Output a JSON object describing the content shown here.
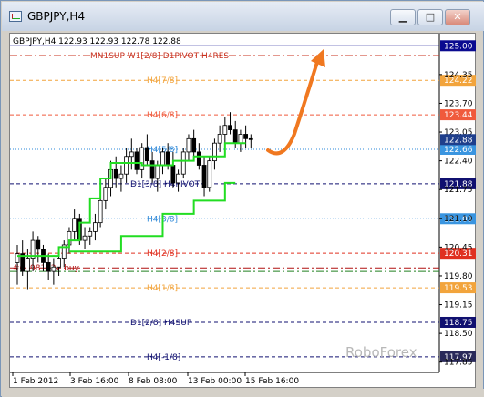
{
  "window": {
    "title": "GBPJPY,H4",
    "buttons": {
      "minimize": "▁",
      "maximize": "□",
      "close": "✕"
    }
  },
  "header": {
    "symbol_line": "GBPJPY,H4  122.93 122.93 122.78 122.88"
  },
  "watermark": "RoboForex",
  "price_scale": {
    "ticks": [
      "124.35",
      "123.70",
      "123.05",
      "122.40",
      "121.75",
      "121.10",
      "120.45",
      "119.80",
      "119.15",
      "118.50",
      "117.85"
    ],
    "current_price": "122.88",
    "current_color": "#1f3f8c"
  },
  "levels": [
    {
      "name": "top-line",
      "price": 125.0,
      "label": "",
      "tag": "125.00",
      "color": "#0a0a90",
      "style": "solid",
      "tag_bg": "#0a0a90"
    },
    {
      "name": "mn1sup",
      "price": 124.78,
      "label": "MN1SUP  W1[2/8]  D1PIVOT  H4RES",
      "tag": "",
      "color": "#c8301e",
      "style": "dashdot",
      "tag_bg": ""
    },
    {
      "name": "h4-7-8",
      "price": 124.22,
      "label": "H4[7/8]",
      "tag": "124.22",
      "color": "#f2a43c",
      "style": "dash",
      "tag_bg": "#f2a43c"
    },
    {
      "name": "h4-6-8",
      "price": 123.44,
      "label": "H4[6/8]",
      "tag": "123.44",
      "color": "#f05a3c",
      "style": "dash",
      "tag_bg": "#f05a3c"
    },
    {
      "name": "h4-5-8",
      "price": 122.66,
      "label": "H4[5/8]",
      "tag": "122.66",
      "color": "#2e88d8",
      "style": "dot",
      "tag_bg": "#3a95e0"
    },
    {
      "name": "d1-pivot",
      "price": 121.88,
      "label": "D1[3/8]  H4PIVOT",
      "tag": "121.88",
      "color": "#101070",
      "style": "dash",
      "tag_bg": "#101070"
    },
    {
      "name": "h4-3-8",
      "price": 121.09,
      "label": "H4[3/8]",
      "tag": "121.09",
      "color": "#2e88d8",
      "style": "dot",
      "tag_bg": "#3a95e0"
    },
    {
      "name": "h4-2-8",
      "price": 120.31,
      "label": "H4[2/8]",
      "tag": "120.31",
      "color": "#e03020",
      "style": "dash",
      "tag_bg": "#e03020"
    },
    {
      "name": "buy-line",
      "price": 119.98,
      "label": "#63981522 buy",
      "tag": "",
      "color": "#b01010",
      "style": "dashdot",
      "tag_bg": ""
    },
    {
      "name": "green-line",
      "price": 119.9,
      "label": "",
      "tag": "",
      "color": "#208020",
      "style": "dashdot",
      "tag_bg": ""
    },
    {
      "name": "h4-1-8",
      "price": 119.53,
      "label": "H4[1/8]",
      "tag": "119.53",
      "color": "#f2a43c",
      "style": "dash",
      "tag_bg": "#f2a43c"
    },
    {
      "name": "d1-h4sup",
      "price": 118.75,
      "label": "D1[2/8]  H4SUP",
      "tag": "118.75",
      "color": "#101070",
      "style": "dash",
      "tag_bg": "#101070"
    },
    {
      "name": "h4-0-8",
      "price": 117.97,
      "label": "H4[-1/8]",
      "tag": "117.97",
      "color": "#101070",
      "style": "dash",
      "tag_bg": "#2a2a5a"
    }
  ],
  "time_axis": [
    "1 Feb 2012",
    "3 Feb 16:00",
    "8 Feb 08:00",
    "13 Feb 00:00",
    "15 Feb 16:00"
  ],
  "candles": [
    [
      120.1,
      120.5,
      119.6,
      120.3
    ],
    [
      120.3,
      120.6,
      119.8,
      119.9
    ],
    [
      119.9,
      120.4,
      119.5,
      120.2
    ],
    [
      120.2,
      120.8,
      119.9,
      120.6
    ],
    [
      120.6,
      120.7,
      120.1,
      120.4
    ],
    [
      120.4,
      120.5,
      119.9,
      120.1
    ],
    [
      120.1,
      120.3,
      119.7,
      119.9
    ],
    [
      119.9,
      120.2,
      119.6,
      120.0
    ],
    [
      120.0,
      120.3,
      119.8,
      120.2
    ],
    [
      120.2,
      120.6,
      120.0,
      120.5
    ],
    [
      120.5,
      120.9,
      120.3,
      120.8
    ],
    [
      120.8,
      121.3,
      120.6,
      121.1
    ],
    [
      121.1,
      121.2,
      120.5,
      120.6
    ],
    [
      120.6,
      120.9,
      120.4,
      120.7
    ],
    [
      120.7,
      120.9,
      120.5,
      120.8
    ],
    [
      120.8,
      121.2,
      120.6,
      121.0
    ],
    [
      121.0,
      121.6,
      120.9,
      121.5
    ],
    [
      121.5,
      122.0,
      121.3,
      121.8
    ],
    [
      121.8,
      122.4,
      121.6,
      122.2
    ],
    [
      122.2,
      122.5,
      121.8,
      122.0
    ],
    [
      122.0,
      122.3,
      121.7,
      122.1
    ],
    [
      122.1,
      122.7,
      121.9,
      122.5
    ],
    [
      122.5,
      122.9,
      122.2,
      122.6
    ],
    [
      122.6,
      122.7,
      122.1,
      122.2
    ],
    [
      122.2,
      122.8,
      122.0,
      122.7
    ],
    [
      122.7,
      123.0,
      122.3,
      122.4
    ],
    [
      122.4,
      122.6,
      121.9,
      122.0
    ],
    [
      122.0,
      122.4,
      121.7,
      122.3
    ],
    [
      122.3,
      122.7,
      122.1,
      122.6
    ],
    [
      122.6,
      122.8,
      122.2,
      122.3
    ],
    [
      122.3,
      122.6,
      121.8,
      121.9
    ],
    [
      121.9,
      122.2,
      121.7,
      122.1
    ],
    [
      122.1,
      122.7,
      122.0,
      122.6
    ],
    [
      122.6,
      123.0,
      122.4,
      122.9
    ],
    [
      122.9,
      123.1,
      122.5,
      122.6
    ],
    [
      122.6,
      122.8,
      122.2,
      122.3
    ],
    [
      122.3,
      122.5,
      121.6,
      121.8
    ],
    [
      121.8,
      122.5,
      121.7,
      122.4
    ],
    [
      122.4,
      122.9,
      122.2,
      122.8
    ],
    [
      122.8,
      123.2,
      122.6,
      123.0
    ],
    [
      123.0,
      123.4,
      122.8,
      123.2
    ],
    [
      123.2,
      123.5,
      123.0,
      123.1
    ],
    [
      123.1,
      123.3,
      122.7,
      122.8
    ],
    [
      122.8,
      123.1,
      122.6,
      123.0
    ],
    [
      123.0,
      123.2,
      122.7,
      122.9
    ],
    [
      122.9,
      123.0,
      122.7,
      122.88
    ]
  ],
  "support_line": [
    [
      0,
      120.25
    ],
    [
      8,
      120.25
    ],
    [
      8,
      120.45
    ],
    [
      10,
      120.45
    ],
    [
      10,
      120.6
    ],
    [
      12,
      120.6
    ],
    [
      12,
      121.0
    ],
    [
      14,
      121.0
    ],
    [
      14,
      121.55
    ],
    [
      16,
      121.55
    ],
    [
      16,
      122.0
    ],
    [
      18,
      122.0
    ],
    [
      18,
      122.35
    ],
    [
      24,
      122.35
    ],
    [
      24,
      122.3
    ],
    [
      30,
      122.3
    ],
    [
      30,
      122.4
    ],
    [
      34,
      122.4
    ],
    [
      34,
      122.5
    ],
    [
      40,
      122.5
    ],
    [
      40,
      122.8
    ],
    [
      44,
      122.8
    ]
  ],
  "support_line2": [
    [
      10,
      120.35
    ],
    [
      20,
      120.35
    ],
    [
      20,
      120.7
    ],
    [
      28,
      120.7
    ],
    [
      28,
      121.2
    ],
    [
      34,
      121.2
    ],
    [
      34,
      121.5
    ],
    [
      40,
      121.5
    ],
    [
      40,
      121.9
    ],
    [
      42,
      121.9
    ]
  ],
  "forecast_arrow": {
    "color": "#f07820"
  }
}
